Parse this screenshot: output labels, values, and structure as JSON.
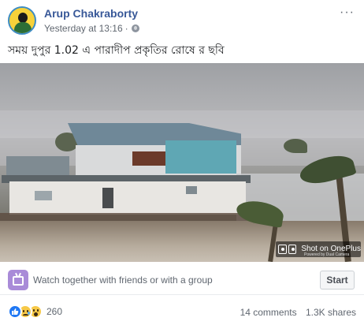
{
  "post": {
    "author": "Arup Chakraborty",
    "timestamp": "Yesterday at 13:16",
    "separator": "·",
    "privacy_icon": "globe-icon",
    "more_icon": "more-options-icon",
    "more_glyph": "···",
    "caption": "সময় দুপুর 1.02 এ পারাদীপ প্রকৃতির রোষে র ছবি"
  },
  "video": {
    "watermark_brand": "Shot on OnePlus",
    "watermark_sub": "Powered by Dual Camera"
  },
  "watch_together": {
    "icon": "watch-party-icon",
    "text": "Watch together with friends or with a group",
    "button_label": "Start"
  },
  "footer": {
    "reaction_icons": [
      "like-icon",
      "sad-icon",
      "wow-icon"
    ],
    "reaction_count": "260",
    "comments": "14 comments",
    "shares": "1.3K shares"
  },
  "colors": {
    "author_link": "#385898",
    "secondary_text": "#606770",
    "like_blue": "#2078f4",
    "watch_icon_purple": "#a98bd8"
  }
}
